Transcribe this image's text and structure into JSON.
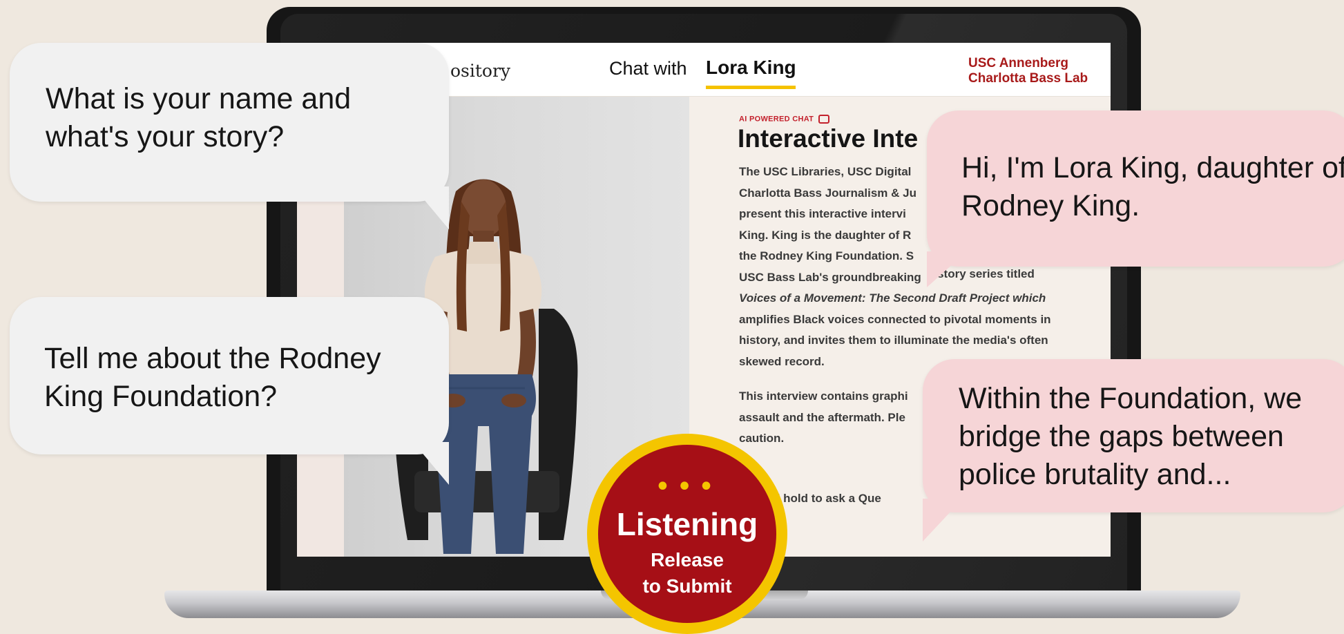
{
  "screen": {
    "nav_left_fragment": "ository",
    "chat_prefix": "Chat with",
    "chat_name": "Lora King",
    "org_line1": "USC Annenberg",
    "org_line2": "Charlotta Bass Lab",
    "ai_badge": "AI POWERED CHAT",
    "heading_fragment": "Interactive Inte",
    "body_lines": [
      "The USC Libraries, USC Digital",
      "Charlotta Bass Journalism & Ju",
      "present this interactive intervi",
      "King. King is the daughter of R",
      "the Rodney King Foundation. S",
      "USC Bass Lab's groundbreaking",
      "Voices of a Movement: The Second Draft Project which",
      "amplifies Black voices connected to pivotal moments in",
      "history, and invites them to illuminate the media's often",
      "skewed record."
    ],
    "body_partial_right": "nistory series titled",
    "warning_lines": [
      "This interview contains graphi",
      "assault and the aftermath. Ple",
      "caution."
    ],
    "hint_fragment": "k and hold to ask a Que"
  },
  "bubbles": {
    "question1": "What is your name and what's your story?",
    "question2": "Tell me about the Rodney King Foundation?",
    "answer1": "Hi, I'm Lora King, daughter of Rodney King.",
    "answer2": "Within the Foundation, we bridge the gaps between police brutality and..."
  },
  "listening": {
    "dots": "•••",
    "title": "Listening",
    "subtitle_line1": "Release",
    "subtitle_line2": "to Submit"
  },
  "colors": {
    "page_background": "#efe8df",
    "accent_red": "#a60f16",
    "accent_yellow": "#f4c500",
    "bubble_gray": "#f1f1f1",
    "bubble_pink": "#f6d5d7"
  }
}
